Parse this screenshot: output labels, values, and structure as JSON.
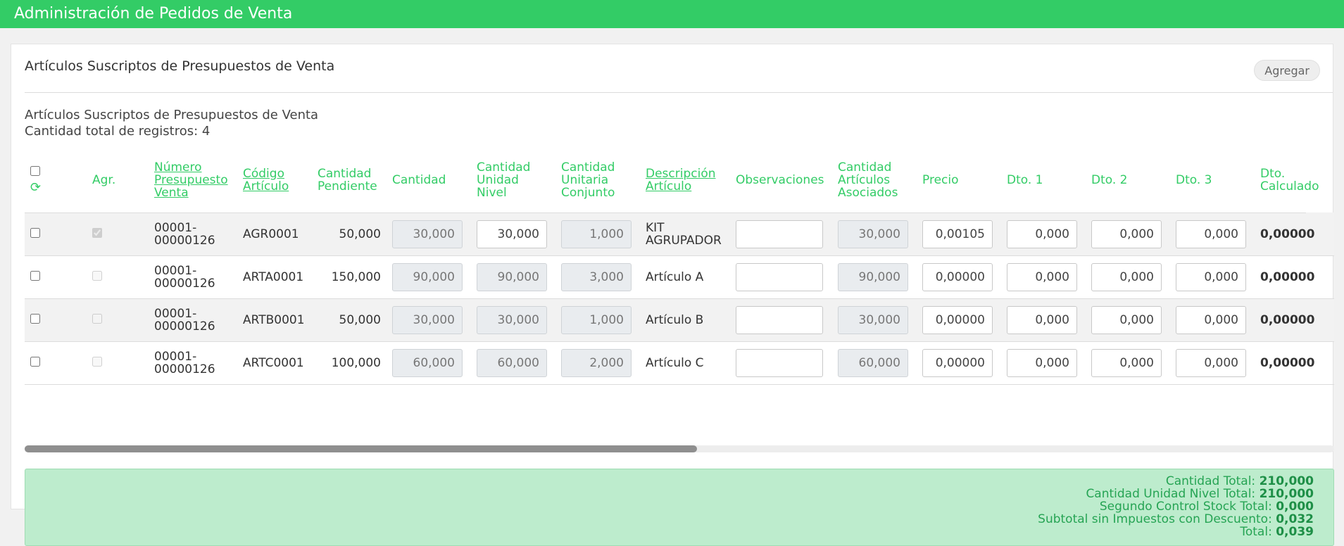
{
  "header": {
    "title": "Administración de Pedidos de Venta"
  },
  "panel": {
    "title": "Artículos Suscriptos de Presupuestos de Venta",
    "add_button": "Agregar",
    "list_title": "Artículos Suscriptos de Presupuestos de Venta",
    "record_count": "Cantidad total de registros: 4"
  },
  "columns": {
    "agr": "Agr.",
    "numero": "Número Presupuesto Venta",
    "codigo": "Código Artículo",
    "pendiente": "Cantidad Pendiente",
    "cantidad": "Cantidad",
    "unidad_nivel": "Cantidad Unidad Nivel",
    "unitaria": "Cantidad Unitaria Conjunto",
    "descripcion": "Descripción Artículo",
    "observaciones": "Observaciones",
    "asociados": "Cantidad Artículos Asociados",
    "precio": "Precio",
    "dto1": "Dto. 1",
    "dto2": "Dto. 2",
    "dto3": "Dto. 3",
    "dto_calc": "Dto. Calculado"
  },
  "rows": [
    {
      "numero": "00001-00000126",
      "codigo": "AGR0001",
      "pendiente": "50,000",
      "cantidad": "30,000",
      "unidad_nivel": "30,000",
      "unitaria": "1,000",
      "descripcion": "KIT AGRUPADOR",
      "observaciones": "",
      "asociados": "30,000",
      "precio": "0,00105",
      "dto1": "0,000",
      "dto2": "0,000",
      "dto3": "0,000",
      "dto_calc": "0,00000"
    },
    {
      "numero": "00001-00000126",
      "codigo": "ARTA0001",
      "pendiente": "150,000",
      "cantidad": "90,000",
      "unidad_nivel": "90,000",
      "unitaria": "3,000",
      "descripcion": "Artículo A",
      "observaciones": "",
      "asociados": "90,000",
      "precio": "0,00000",
      "dto1": "0,000",
      "dto2": "0,000",
      "dto3": "0,000",
      "dto_calc": "0,00000"
    },
    {
      "numero": "00001-00000126",
      "codigo": "ARTB0001",
      "pendiente": "50,000",
      "cantidad": "30,000",
      "unidad_nivel": "30,000",
      "unitaria": "1,000",
      "descripcion": "Artículo B",
      "observaciones": "",
      "asociados": "30,000",
      "precio": "0,00000",
      "dto1": "0,000",
      "dto2": "0,000",
      "dto3": "0,000",
      "dto_calc": "0,00000"
    },
    {
      "numero": "00001-00000126",
      "codigo": "ARTC0001",
      "pendiente": "100,000",
      "cantidad": "60,000",
      "unidad_nivel": "60,000",
      "unitaria": "2,000",
      "descripcion": "Artículo C",
      "observaciones": "",
      "asociados": "60,000",
      "precio": "0,00000",
      "dto1": "0,000",
      "dto2": "0,000",
      "dto3": "0,000",
      "dto_calc": "0,00000"
    }
  ],
  "totals": {
    "cantidad_label": "Cantidad Total:",
    "cantidad_value": "210,000",
    "unidad_label": "Cantidad Unidad Nivel Total:",
    "unidad_value": "210,000",
    "segundo_label": "Segundo Control Stock Total:",
    "segundo_value": "0,000",
    "subtotal_label": "Subtotal sin Impuestos con Descuento:",
    "subtotal_value": "0,032",
    "total_label": "Total:",
    "total_value": "0,039"
  },
  "colors": {
    "accent": "#33cc66",
    "totals_bg": "#bdeccd"
  },
  "icons": {
    "refresh": "refresh-icon"
  }
}
